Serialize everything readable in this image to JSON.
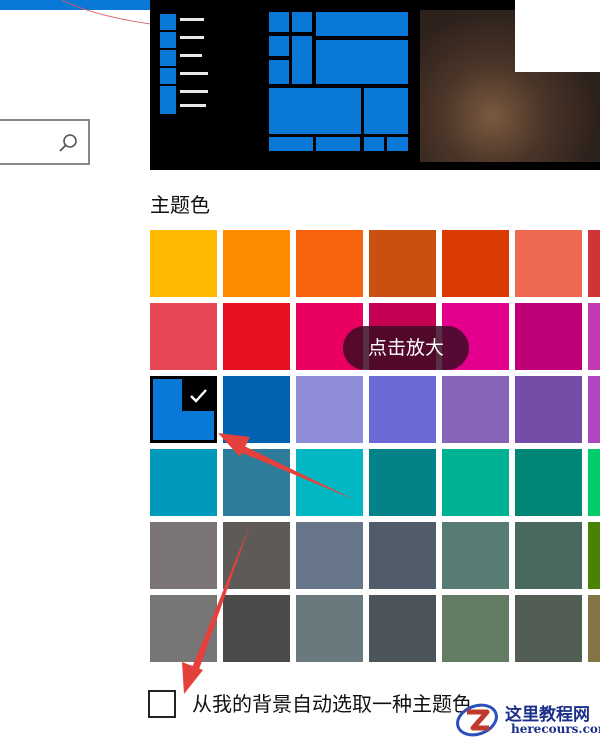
{
  "theme": {
    "accent": "#0A78D6",
    "selected_swatch": "#0A78D6"
  },
  "search": {
    "icon": "search-icon"
  },
  "section": {
    "title": "主题色"
  },
  "swatches": [
    [
      "#FFB900",
      "#FF8C00",
      "#F7630C",
      "#CA5010",
      "#DA3B01",
      "#EF6950",
      "#D13438"
    ],
    [
      "#E74856",
      "#E81123",
      "#EA005E",
      "#C30052",
      "#E3008C",
      "#BF0077",
      "#C239B3"
    ],
    [
      "#0A78D6",
      "#0063B1",
      "#8E8CD8",
      "#6B69D6",
      "#8764B8",
      "#744DA9",
      "#B146C2"
    ],
    [
      "#0099BC",
      "#2D7D9A",
      "#00B7C3",
      "#038387",
      "#00B294",
      "#018574",
      "#00CC6A"
    ],
    [
      "#7A7574",
      "#5D5A58",
      "#68768A",
      "#515C6B",
      "#567C73",
      "#486860",
      "#498205"
    ],
    [
      "#767676",
      "#4C4A48",
      "#69797E",
      "#4A5459",
      "#647C64",
      "#525E54",
      "#847545"
    ]
  ],
  "tooltip": {
    "text": "点击放大"
  },
  "auto_pick": {
    "label": "从我的背景自动选取一种主题色",
    "checked": false
  },
  "watermark": {
    "name": "这里教程网",
    "url": "herecours.com"
  }
}
